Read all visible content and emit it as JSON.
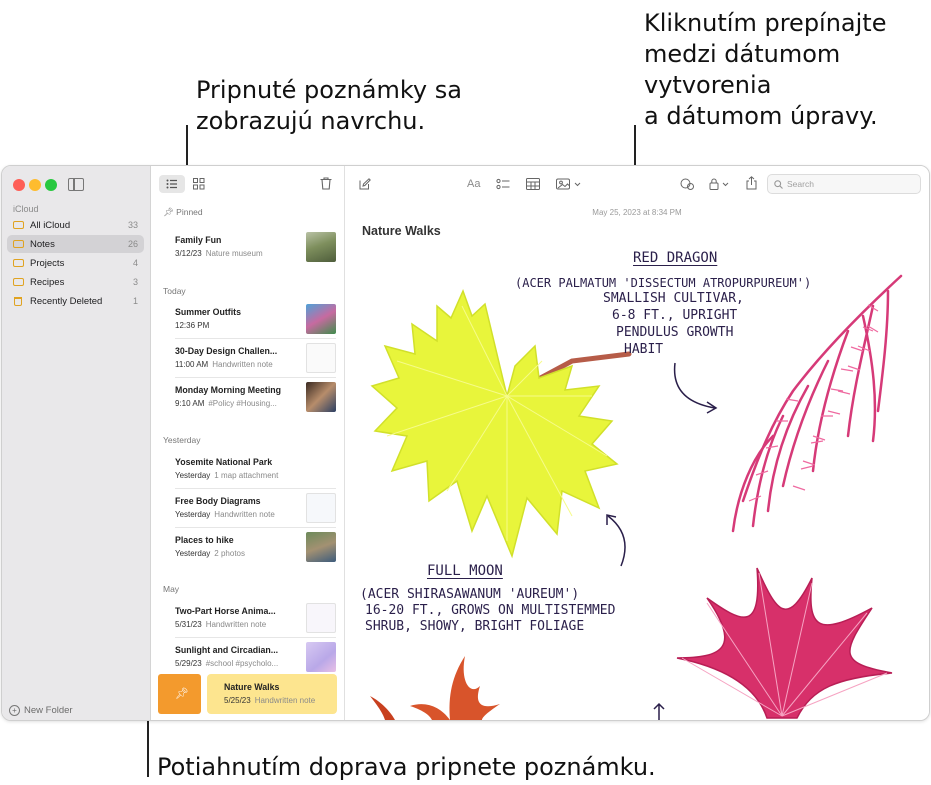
{
  "callouts": {
    "pinned": "Pripnuté poznámky sa\nzobrazujú navrchu.",
    "date_toggle": "Kliknutím prepínajte\nmedzi dátumom\nvytvorenia\na dátumom úpravy.",
    "swipe": "Potiahnutím doprava pripnete poznámku."
  },
  "sidebar": {
    "section": "iCloud",
    "items": [
      {
        "label": "All iCloud",
        "count": "33"
      },
      {
        "label": "Notes",
        "count": "26"
      },
      {
        "label": "Projects",
        "count": "4"
      },
      {
        "label": "Recipes",
        "count": "3"
      },
      {
        "label": "Recently Deleted",
        "count": "1"
      }
    ],
    "new_folder": "New Folder"
  },
  "list": {
    "groups": {
      "pinned": "Pinned",
      "today": "Today",
      "yesterday": "Yesterday",
      "may": "May"
    },
    "notes": [
      {
        "title": "Family Fun",
        "date": "3/12/23",
        "snippet": "Nature museum"
      },
      {
        "title": "Summer Outfits",
        "date": "12:36 PM",
        "snippet": ""
      },
      {
        "title": "30-Day Design Challen...",
        "date": "11:00 AM",
        "snippet": "Handwritten note"
      },
      {
        "title": "Monday Morning Meeting",
        "date": "9:10 AM",
        "snippet": "#Policy #Housing..."
      },
      {
        "title": "Yosemite National Park",
        "date": "Yesterday",
        "snippet": "1 map attachment"
      },
      {
        "title": "Free Body Diagrams",
        "date": "Yesterday",
        "snippet": "Handwritten note"
      },
      {
        "title": "Places to hike",
        "date": "Yesterday",
        "snippet": "2 photos"
      },
      {
        "title": "Two-Part Horse Anima...",
        "date": "5/31/23",
        "snippet": "Handwritten note"
      },
      {
        "title": "Sunlight and Circadian...",
        "date": "5/29/23",
        "snippet": "#school #psycholo..."
      },
      {
        "title": "Nature Walks",
        "date": "5/25/23",
        "snippet": "Handwritten note"
      }
    ]
  },
  "editor": {
    "search_placeholder": "Search",
    "format_label": "Aa",
    "date": "May 25, 2023 at 8:34 PM",
    "title": "Nature Walks",
    "hw": {
      "red_dragon_title": "RED DRAGON",
      "red_dragon_l1": "(ACER PALMATUM 'DISSECTUM ATROPURPUREUM')",
      "red_dragon_l2": "SMALLISH CULTIVAR,",
      "red_dragon_l3": "6-8 FT., UPRIGHT",
      "red_dragon_l4": "PENDULUS GROWTH",
      "red_dragon_l5": "HABIT",
      "full_moon_title": "FULL MOON",
      "full_moon_l1": "(ACER SHIRASAWANUM 'AUREUM')",
      "full_moon_l2": "16-20 FT., GROWS ON MULTISTEMMED",
      "full_moon_l3": "SHRUB, SHOWY, BRIGHT FOLIAGE"
    }
  },
  "colors": {
    "accent": "#e0a321",
    "pin_swipe": "#f39a2d",
    "highlight": "#fde58f",
    "leaf_yellow": "#e7f53a",
    "leaf_pink": "#d42a6e"
  }
}
